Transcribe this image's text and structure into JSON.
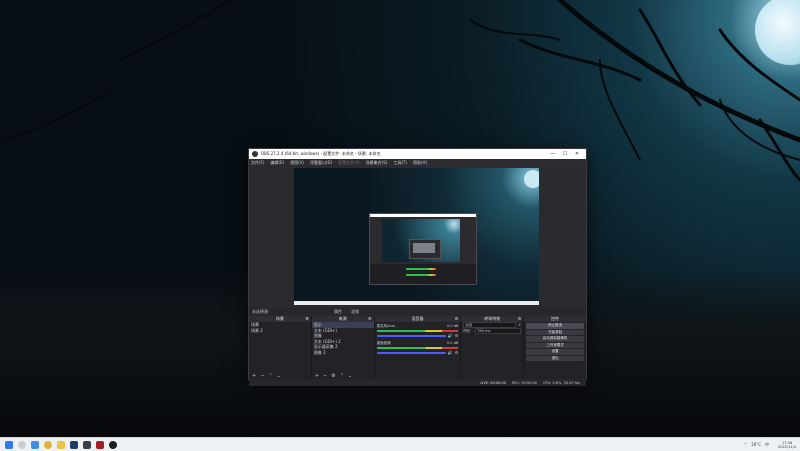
{
  "window": {
    "title": "OBS 27.2.4 (64-bit, windows) - 配置文件: 未命名 - 场景: 未命名",
    "controls": [
      "—",
      "☐",
      "✕"
    ]
  },
  "menu": [
    "文件(F)",
    "编辑(E)",
    "视图(V)",
    "停靠窗口(D)",
    "配置文件(P)",
    "场景集合(S)",
    "工具(T)",
    "帮助(H)"
  ],
  "source_bar": {
    "no_source": "未选择源",
    "properties": "属性",
    "filters": "滤镜"
  },
  "scenes": {
    "header": "场景",
    "items": [
      "场景",
      "场景 2"
    ]
  },
  "sources": {
    "header": "来源",
    "items": [
      "显示",
      "文本 (GDI+)",
      "图像",
      "文本 (GDI+) 2",
      "显示器采集 2",
      "图像 2"
    ]
  },
  "mixer": {
    "header": "混音器",
    "channels": [
      {
        "name": "麦克风/Aux",
        "db": "0.0 dB"
      },
      {
        "name": "桌面音频",
        "db": "0.0 dB"
      }
    ]
  },
  "transitions": {
    "header": "转场特效",
    "type_label": "淡出",
    "duration_label": "时长",
    "duration": "300 ms"
  },
  "controls": {
    "header": "控件",
    "buttons": [
      "停止推流",
      "开始录制",
      "启动虚拟摄像机",
      "工作室模式",
      "设置",
      "退出"
    ]
  },
  "status": {
    "live": "LIVE: 00:00:00",
    "rec": "REC: 00:00:00",
    "cpu": "CPU: 0.6%, 30.00 fps"
  },
  "taskbar": {
    "tray": {
      "temp": "16°C",
      "lang": "中",
      "time": "17:46",
      "date": "2022/11/4"
    }
  }
}
